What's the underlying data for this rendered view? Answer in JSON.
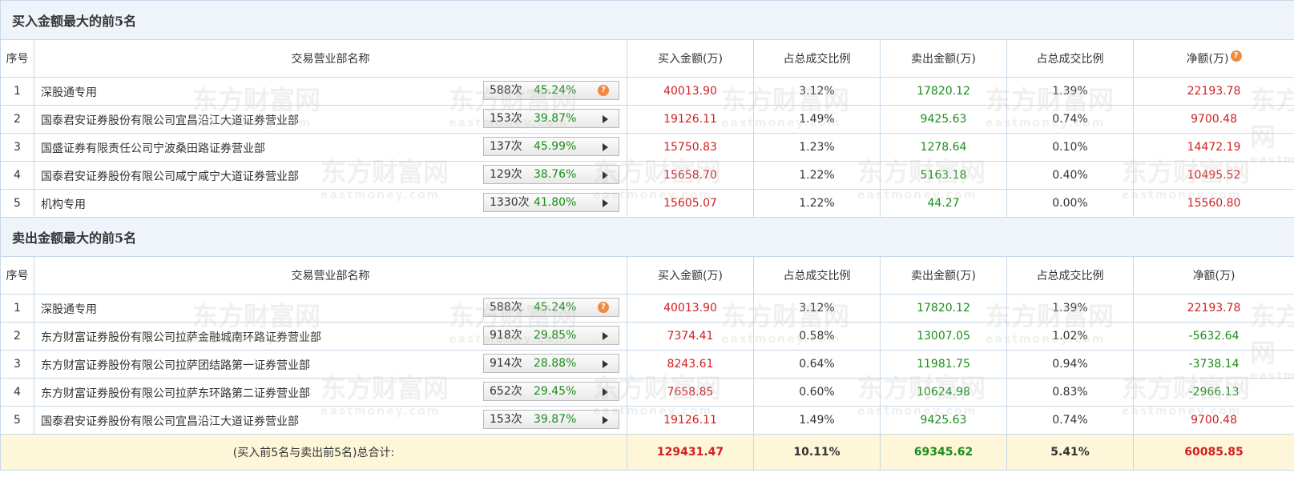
{
  "buy_section": {
    "title": "买入金额最大的前5名",
    "headers": [
      "序号",
      "交易营业部名称",
      "买入金额(万)",
      "占总成交比例",
      "卖出金额(万)",
      "占总成交比例",
      "净额(万)"
    ],
    "rows": [
      {
        "idx": "1",
        "name": "深股通专用",
        "count": "588次",
        "pct": "45.24%",
        "icon": "help-icon",
        "buy": "40013.90",
        "buy_pct": "3.12%",
        "sell": "17820.12",
        "sell_pct": "1.39%",
        "net": "22193.78"
      },
      {
        "idx": "2",
        "name": "国泰君安证券股份有限公司宜昌沿江大道证券营业部",
        "count": "153次",
        "pct": "39.87%",
        "icon": "play-arrow-icon",
        "buy": "19126.11",
        "buy_pct": "1.49%",
        "sell": "9425.63",
        "sell_pct": "0.74%",
        "net": "9700.48"
      },
      {
        "idx": "3",
        "name": "国盛证券有限责任公司宁波桑田路证券营业部",
        "count": "137次",
        "pct": "45.99%",
        "icon": "play-arrow-icon",
        "buy": "15750.83",
        "buy_pct": "1.23%",
        "sell": "1278.64",
        "sell_pct": "0.10%",
        "net": "14472.19"
      },
      {
        "idx": "4",
        "name": "国泰君安证券股份有限公司咸宁咸宁大道证券营业部",
        "count": "129次",
        "pct": "38.76%",
        "icon": "play-arrow-icon",
        "buy": "15658.70",
        "buy_pct": "1.22%",
        "sell": "5163.18",
        "sell_pct": "0.40%",
        "net": "10495.52"
      },
      {
        "idx": "5",
        "name": "机构专用",
        "count": "1330次",
        "pct": "41.80%",
        "icon": "play-arrow-icon",
        "buy": "15605.07",
        "buy_pct": "1.22%",
        "sell": "44.27",
        "sell_pct": "0.00%",
        "net": "15560.80"
      }
    ]
  },
  "sell_section": {
    "title": "卖出金额最大的前5名",
    "headers": [
      "序号",
      "交易营业部名称",
      "买入金额(万)",
      "占总成交比例",
      "卖出金额(万)",
      "占总成交比例",
      "净额(万)"
    ],
    "rows": [
      {
        "idx": "1",
        "name": "深股通专用",
        "count": "588次",
        "pct": "45.24%",
        "icon": "help-icon",
        "buy": "40013.90",
        "buy_pct": "3.12%",
        "sell": "17820.12",
        "sell_pct": "1.39%",
        "net": "22193.78"
      },
      {
        "idx": "2",
        "name": "东方财富证券股份有限公司拉萨金融城南环路证券营业部",
        "count": "918次",
        "pct": "29.85%",
        "icon": "play-arrow-icon",
        "buy": "7374.41",
        "buy_pct": "0.58%",
        "sell": "13007.05",
        "sell_pct": "1.02%",
        "net": "-5632.64"
      },
      {
        "idx": "3",
        "name": "东方财富证券股份有限公司拉萨团结路第一证券营业部",
        "count": "914次",
        "pct": "28.88%",
        "icon": "play-arrow-icon",
        "buy": "8243.61",
        "buy_pct": "0.64%",
        "sell": "11981.75",
        "sell_pct": "0.94%",
        "net": "-3738.14"
      },
      {
        "idx": "4",
        "name": "东方财富证券股份有限公司拉萨东环路第二证券营业部",
        "count": "652次",
        "pct": "29.45%",
        "icon": "play-arrow-icon",
        "buy": "7658.85",
        "buy_pct": "0.60%",
        "sell": "10624.98",
        "sell_pct": "0.83%",
        "net": "-2966.13"
      },
      {
        "idx": "5",
        "name": "国泰君安证券股份有限公司宜昌沿江大道证券营业部",
        "count": "153次",
        "pct": "39.87%",
        "icon": "play-arrow-icon",
        "buy": "19126.11",
        "buy_pct": "1.49%",
        "sell": "9425.63",
        "sell_pct": "0.74%",
        "net": "9700.48"
      }
    ]
  },
  "total": {
    "label": "(买入前5名与卖出前5名)总合计:",
    "buy": "129431.47",
    "buy_pct": "10.11%",
    "sell": "69345.62",
    "sell_pct": "5.41%",
    "net": "60085.85"
  },
  "help_glyph": "?",
  "watermark": {
    "cn": "东方财富网",
    "en": "eastmoney.com"
  },
  "colors": {
    "positive": "#d02020",
    "negative": "#1a8d1a",
    "header_bg": "#eef4fa",
    "total_bg": "#fdf6d8",
    "border": "#c8d8e8",
    "help_badge": "#f08a3c"
  }
}
